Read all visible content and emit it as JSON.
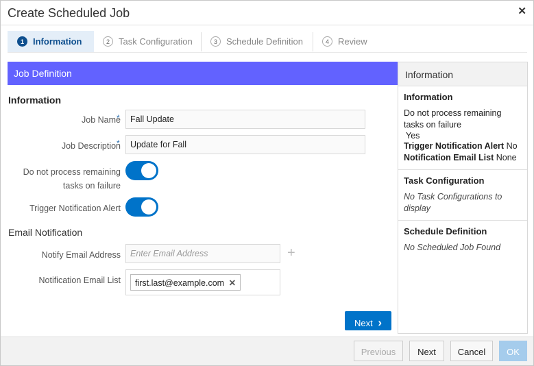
{
  "dialog": {
    "title": "Create Scheduled Job",
    "close_glyph": "✕"
  },
  "train": [
    {
      "num": "1",
      "label": "Information"
    },
    {
      "num": "2",
      "label": "Task Configuration"
    },
    {
      "num": "3",
      "label": "Schedule Definition"
    },
    {
      "num": "4",
      "label": "Review"
    }
  ],
  "form": {
    "section_title": "Job Definition",
    "info_heading": "Information",
    "job_name_label": "Job Name",
    "job_name_value": "Fall Update",
    "job_desc_label": "Job Description",
    "job_desc_value": "Update for Fall",
    "required_mark": "*",
    "no_process_label_1": "Do not process remaining",
    "no_process_label_2": "tasks on failure",
    "trigger_label": "Trigger Notification Alert",
    "email_heading": "Email Notification",
    "notify_label": "Notify Email Address",
    "notify_placeholder": "Enter Email Address",
    "add_glyph": "+",
    "list_label": "Notification Email List",
    "list_chip": "first.last@example.com",
    "chip_remove_glyph": "✕",
    "next_label": "Next",
    "next_glyph": "›"
  },
  "summary": {
    "header": "Information",
    "info_title": "Information",
    "no_process_label": "Do not process remaining tasks on failure",
    "no_process_value": "Yes",
    "trigger_label": "Trigger Notification Alert",
    "trigger_value": "No",
    "email_list_label": "Notification Email List",
    "email_list_value": "None",
    "task_title": "Task Configuration",
    "task_text": "No Task Configurations to display",
    "schedule_title": "Schedule Definition",
    "schedule_text": "No Scheduled Job Found"
  },
  "footer": {
    "previous": "Previous",
    "next": "Next",
    "cancel": "Cancel",
    "ok": "OK"
  },
  "colors": {
    "accent": "#0073c9",
    "section_header": "#6262ff",
    "active_step": "#0e4f8e"
  }
}
